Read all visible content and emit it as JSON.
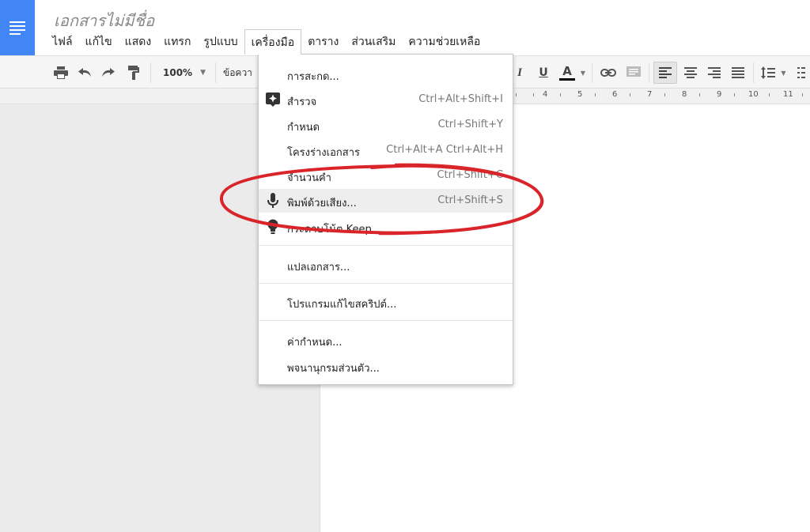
{
  "document": {
    "title": "เอกสารไม่มีชื่อ"
  },
  "menu": [
    "ไฟล์",
    "แก้ไข",
    "แสดง",
    "แทรก",
    "รูปแบบ",
    "เครื่องมือ",
    "ตาราง",
    "ส่วนเสริม",
    "ความช่วยเหลือ"
  ],
  "toolbar": {
    "zoom": "100%",
    "style_partial": "ข้อควา",
    "text_color_letter": "A",
    "italic_letter": "I",
    "underline_letter": "U"
  },
  "ruler": [
    "4",
    "5",
    "6",
    "7",
    "8",
    "9",
    "10",
    "11"
  ],
  "tools_menu": {
    "items": [
      {
        "label": "การสะกด...",
        "shortcut": ""
      },
      {
        "label": "สำรวจ",
        "shortcut": "Ctrl+Alt+Shift+I",
        "icon": "explore-icon"
      },
      {
        "label": "กำหนด",
        "shortcut": "Ctrl+Shift+Y"
      },
      {
        "label": "โครงร่างเอกสาร",
        "shortcut": "Ctrl+Alt+A Ctrl+Alt+H"
      },
      {
        "label": "จำนวนคำ",
        "shortcut": "Ctrl+Shift+C"
      },
      {
        "label": "พิมพ์ด้วยเสียง...",
        "shortcut": "Ctrl+Shift+S",
        "icon": "microphone-icon"
      },
      {
        "label": "กระดาษโน้ต Keep",
        "shortcut": "",
        "icon": "lightbulb-icon"
      },
      {
        "label": "แปลเอกสาร...",
        "shortcut": ""
      },
      {
        "label": "โปรแกรมแก้ไขสคริปต์...",
        "shortcut": ""
      },
      {
        "label": "ค่ากำหนด...",
        "shortcut": ""
      },
      {
        "label": "พจนานุกรมส่วนตัว...",
        "shortcut": ""
      }
    ]
  },
  "colors": {
    "brand_blue": "#4285f4",
    "annotation_red": "#d9252a",
    "text_color_underline": "#000000"
  }
}
